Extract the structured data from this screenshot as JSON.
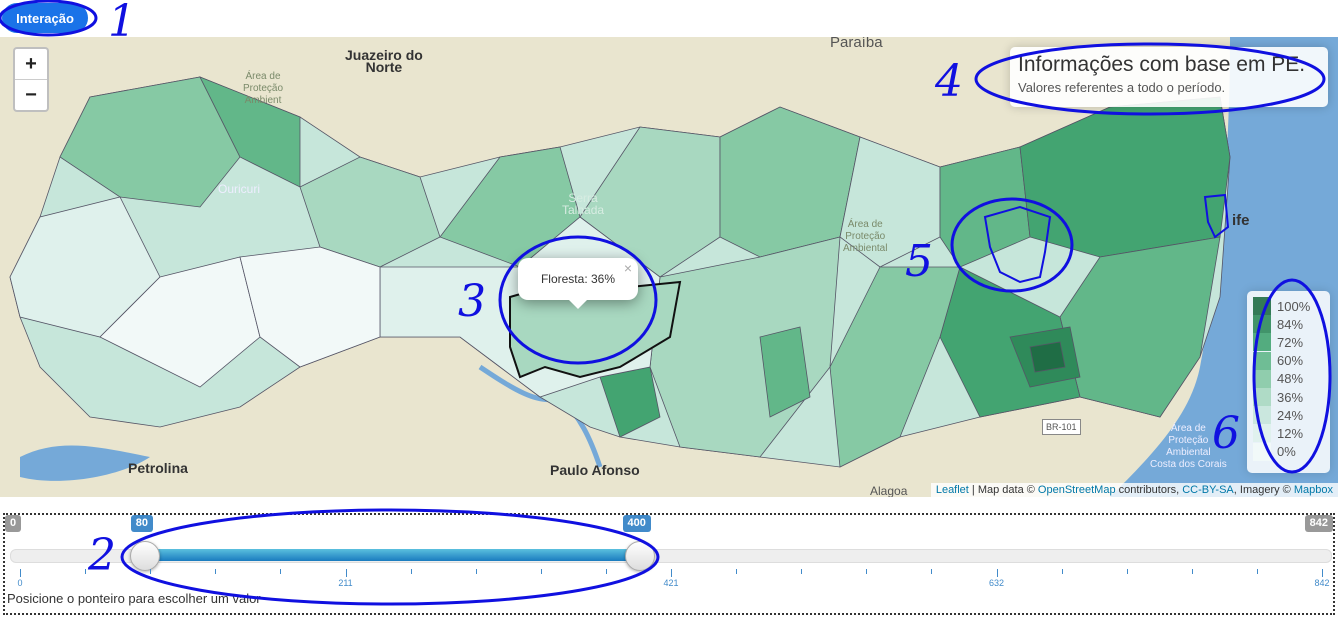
{
  "toolbar": {
    "interaction_label": "Interação"
  },
  "map": {
    "zoom_in": "+",
    "zoom_out": "−",
    "places": [
      {
        "name": "Juazeiro do Norte",
        "label": "Juazeiro do\nNorte"
      },
      {
        "name": "Paraíba",
        "label": "Paraíba"
      },
      {
        "name": "Ouricuri",
        "label": "Ouricuri"
      },
      {
        "name": "Serra Talhada",
        "label": "Serra\nTalhada"
      },
      {
        "name": "Paulo Afonso",
        "label": "Paulo Afonso"
      },
      {
        "name": "Petrolina",
        "label": "Petrolina"
      },
      {
        "name": "Recife",
        "label": "ife"
      },
      {
        "name": "BR-101",
        "label": "BR-101"
      },
      {
        "name": "Area de Protecao Ambiental",
        "label": "Área de\nProteção\nAmbiental\nCosta dos Corais"
      },
      {
        "name": "Area de Protecao",
        "label": "Área de\nProteção\nAmbiental"
      },
      {
        "name": "Area de Protecao 2",
        "label": "Área de\nProteção\nAmbient"
      },
      {
        "name": "Alagoas",
        "label": "Alagoa"
      }
    ],
    "info": {
      "title": "Informações com base em PE.",
      "subtitle": "Valores referentes a todo o período."
    },
    "popup": {
      "text": "Floresta: 36%",
      "close": "×"
    },
    "legend": [
      {
        "label": "100%",
        "color": "#1f6d45"
      },
      {
        "label": "84%",
        "color": "#2f8a5a"
      },
      {
        "label": "72%",
        "color": "#43a471"
      },
      {
        "label": "60%",
        "color": "#62b789"
      },
      {
        "label": "48%",
        "color": "#86c9a4"
      },
      {
        "label": "36%",
        "color": "#a8d8c0"
      },
      {
        "label": "24%",
        "color": "#c6e6da"
      },
      {
        "label": "12%",
        "color": "#dff1ec"
      },
      {
        "label": "0%",
        "color": "#f2f9f8"
      }
    ],
    "attribution": {
      "leaflet": "Leaflet",
      "mid": " | Map data © ",
      "osm": "OpenStreetMap",
      "contrib": " contributors, ",
      "cc": "CC-BY-SA",
      "imagery": ", Imagery © ",
      "mapbox": "Mapbox"
    }
  },
  "slider": {
    "min": "0",
    "max": "842",
    "from": "80",
    "to": "400",
    "from_value": 80,
    "to_value": 400,
    "range_max": 842,
    "tick_labels": [
      "0",
      "211",
      "421",
      "632",
      "842"
    ],
    "hint": "Posicione o ponteiro para escolher um valor"
  },
  "annotations": [
    "1",
    "2",
    "3",
    "4",
    "5",
    "6"
  ],
  "colors": {
    "accent": "#1a73e8",
    "annotation": "#1010e0",
    "water": "#75a9d8"
  }
}
